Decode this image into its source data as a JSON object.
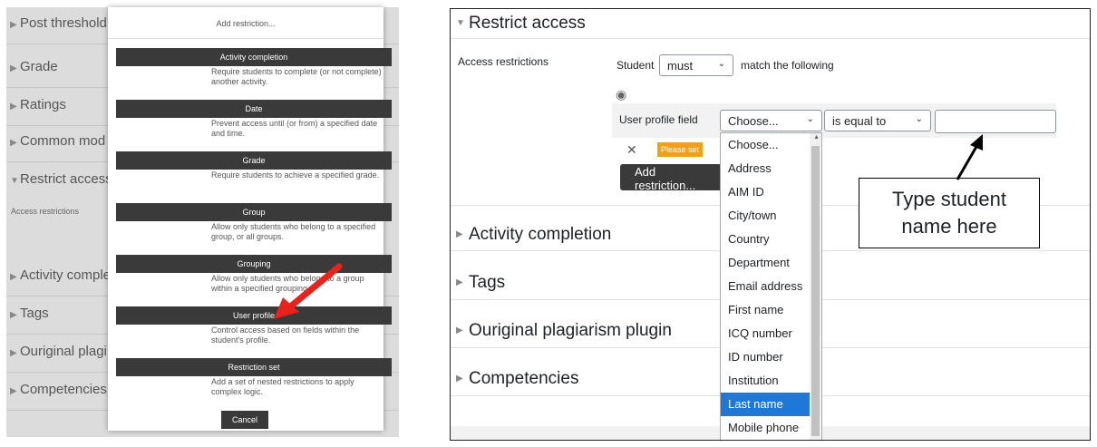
{
  "left": {
    "sections": [
      {
        "label": "Post threshold"
      },
      {
        "label": "Grade"
      },
      {
        "label": "Ratings"
      },
      {
        "label": "Common mod"
      },
      {
        "label": "Restrict access",
        "expanded": true
      },
      {
        "label": "Activity comple"
      },
      {
        "label": "Tags"
      },
      {
        "label": "Ouriginal plagi"
      },
      {
        "label": "Competencies"
      }
    ],
    "access_restrictions_label": "Access restrictions",
    "modal": {
      "title": "Add restriction...",
      "options": [
        {
          "label": "Activity completion",
          "desc": "Require students to complete (or not complete) another activity."
        },
        {
          "label": "Date",
          "desc": "Prevent access until (or from) a specified date and time."
        },
        {
          "label": "Grade",
          "desc": "Require students to achieve a specified grade."
        },
        {
          "label": "Group",
          "desc": "Allow only students who belong to a specified group, or all groups."
        },
        {
          "label": "Grouping",
          "desc": "Allow only students who belong to a group within a specified grouping."
        },
        {
          "label": "User profile",
          "desc": "Control access based on fields within the student's profile."
        },
        {
          "label": "Restriction set",
          "desc": "Add a set of nested restrictions to apply complex logic."
        }
      ],
      "cancel": "Cancel"
    }
  },
  "right": {
    "restrict_access": "Restrict access",
    "access_restrictions_label": "Access restrictions",
    "student_label": "Student",
    "must_value": "must",
    "match_label": "match the following",
    "user_profile_field_label": "User profile field",
    "field_value": "Choose...",
    "operator_value": "is equal to",
    "please_set": "Please set",
    "add_restriction": "Add restriction...",
    "callout": [
      "Type student",
      "name here"
    ],
    "dropdown": {
      "items": [
        "Choose...",
        "Address",
        "AIM ID",
        "City/town",
        "Country",
        "Department",
        "Email address",
        "First name",
        "ICQ number",
        "ID number",
        "Institution",
        "Last name",
        "Mobile phone"
      ],
      "selected_index": 11
    },
    "sections": [
      "Activity completion",
      "Tags",
      "Ouriginal plagiarism plugin",
      "Competencies"
    ]
  },
  "colors": {
    "highlight": "#1e78d7",
    "badge": "#f0a019",
    "arrow": "#e8231c"
  }
}
